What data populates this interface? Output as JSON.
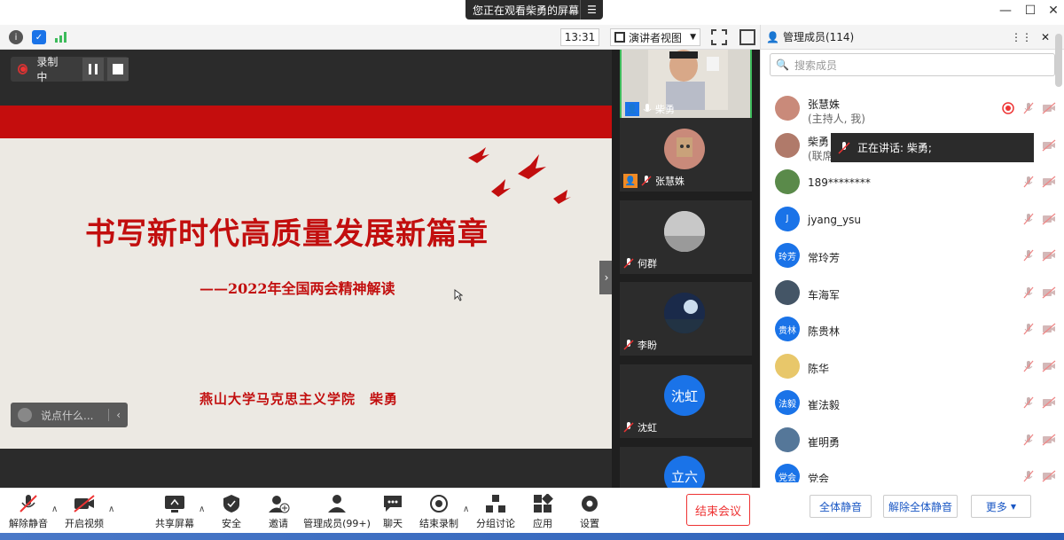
{
  "share_banner": {
    "text": "您正在观看柴勇的屏幕"
  },
  "window": {
    "minimize": "—",
    "maximize": "☐",
    "close": "✕"
  },
  "toolbar": {
    "time": "13:31",
    "view_mode": "演讲者视图"
  },
  "recording": {
    "label": "录制中"
  },
  "slide": {
    "title": "书写新时代高质量发展新篇章",
    "subtitle": "——2022年全国两会精神解读",
    "author": "燕山大学马克思主义学院　柴勇"
  },
  "chat": {
    "placeholder": "说点什么..."
  },
  "video_tiles": [
    {
      "name": "柴勇",
      "avatar": "",
      "muted": false
    },
    {
      "name": "张慧姝",
      "avatar": "",
      "muted": true
    },
    {
      "name": "何群",
      "avatar": "",
      "muted": true
    },
    {
      "name": "李盼",
      "avatar": "",
      "muted": true
    },
    {
      "name": "沈虹",
      "avatar": "沈虹",
      "muted": true
    },
    {
      "name": "",
      "avatar": "立六",
      "muted": true
    }
  ],
  "panel": {
    "title": "管理成员(114)",
    "search_placeholder": "搜索成员",
    "members": [
      {
        "name": "张慧姝",
        "role": "(主持人, 我)",
        "avatar": "",
        "color": "#c98a7a"
      },
      {
        "name": "柴勇",
        "role": "(联席",
        "avatar": "",
        "color": "#b07a6a"
      },
      {
        "name": "189********",
        "role": "",
        "avatar": "",
        "color": "#5a8a4a"
      },
      {
        "name": "jyang_ysu",
        "role": "",
        "avatar": "J",
        "color": "#1a73e8"
      },
      {
        "name": "常玲芳",
        "role": "",
        "avatar": "玲芳",
        "color": "#1a73e8"
      },
      {
        "name": "车海军",
        "role": "",
        "avatar": "",
        "color": "#445566"
      },
      {
        "name": "陈贵林",
        "role": "",
        "avatar": "贵林",
        "color": "#1a73e8"
      },
      {
        "name": "陈华",
        "role": "",
        "avatar": "",
        "color": "#e8c76a"
      },
      {
        "name": "崔法毅",
        "role": "",
        "avatar": "法毅",
        "color": "#1a73e8"
      },
      {
        "name": "崔明勇",
        "role": "",
        "avatar": "",
        "color": "#557799"
      },
      {
        "name": "党会",
        "role": "",
        "avatar": "党会",
        "color": "#1a73e8"
      }
    ],
    "speaking_tip": "正在讲话: 柴勇;",
    "buttons": {
      "mute_all": "全体静音",
      "unmute_all": "解除全体静音",
      "more": "更多"
    }
  },
  "bottom_toolbar": {
    "unmute": "解除静音",
    "video": "开启视频",
    "share": "共享屏幕",
    "security": "安全",
    "invite": "邀请",
    "members": "管理成员(99+)",
    "chat": "聊天",
    "end_recording": "结束录制",
    "breakout": "分组讨论",
    "apps": "应用",
    "settings": "设置",
    "end_meeting": "结束会议"
  },
  "colors": {
    "accent": "#1a73e8",
    "slide_red": "#c20e0e",
    "danger": "#e33333",
    "active_border": "#3dbb5b"
  }
}
